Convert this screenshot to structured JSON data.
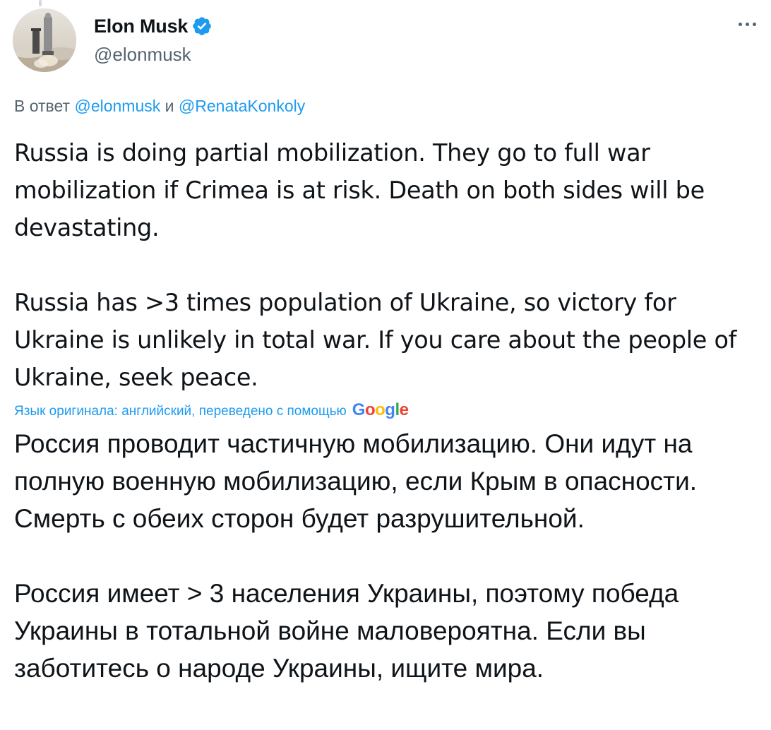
{
  "tweet": {
    "author": {
      "display_name": "Elon Musk",
      "handle": "@elonmusk",
      "verified": true,
      "verified_icon": "verified-badge-icon",
      "avatar_icon": "rocket-launch-avatar"
    },
    "more_icon": "more-options-icon",
    "reply_context": {
      "prefix": "В ответ",
      "first_mention": "@elonmusk",
      "conjunction": "и",
      "second_mention": "@RenataKonkoly"
    },
    "text_original": [
      "Russia is doing partial mobilization. They go to full war mobilization if Crimea is at risk. Death on both sides will be devastating.",
      "Russia has >3 times population of Ukraine, so victory for Ukraine is unlikely in total war. If you care about the people of Ukraine, seek peace."
    ],
    "translation_note": "Язык оригинала: английский, переведено с помощью",
    "translation_provider": "Google",
    "text_translated": [
      "Россия проводит частичную мобилизацию. Они идут на полную военную мобилизацию, если Крым в опасности. Смерть с обеих сторон будет разрушительной.",
      "Россия имеет > 3 населения Украины, поэтому победа Украины в тотальной войне маловероятна. Если вы заботитесь о народе Украины, ищите мира."
    ]
  },
  "colors": {
    "text_primary": "#0f1419",
    "text_secondary": "#536471",
    "link": "#1d9bf0",
    "verified_badge": "#1d9bf0"
  }
}
